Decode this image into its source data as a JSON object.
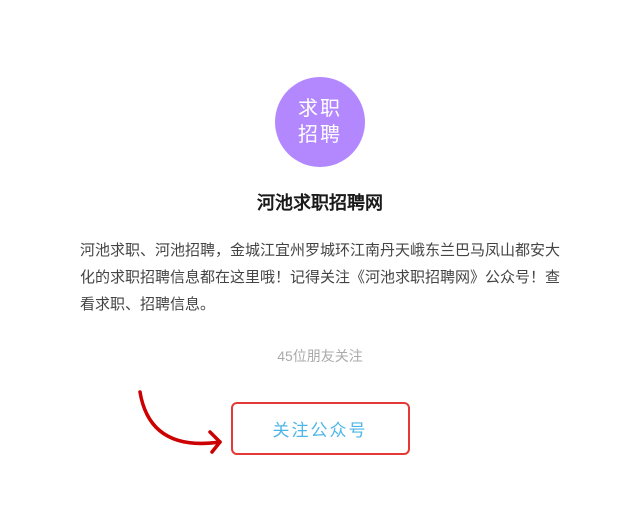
{
  "avatar": {
    "line1": "求职",
    "line2": "招聘",
    "bg_color": "#b388ff"
  },
  "account": {
    "name": "河池求职招聘网"
  },
  "description": {
    "text": "河池求职、河池招聘，金城江宜州罗城环江南丹天峨东兰巴马凤山都安大化的求职招聘信息都在这里哦！记得关注《河池求职招聘网》公众号！查看求职、招聘信息。"
  },
  "stats": {
    "friends_count": "45位朋友关注"
  },
  "follow_button": {
    "label": "关注公众号"
  }
}
